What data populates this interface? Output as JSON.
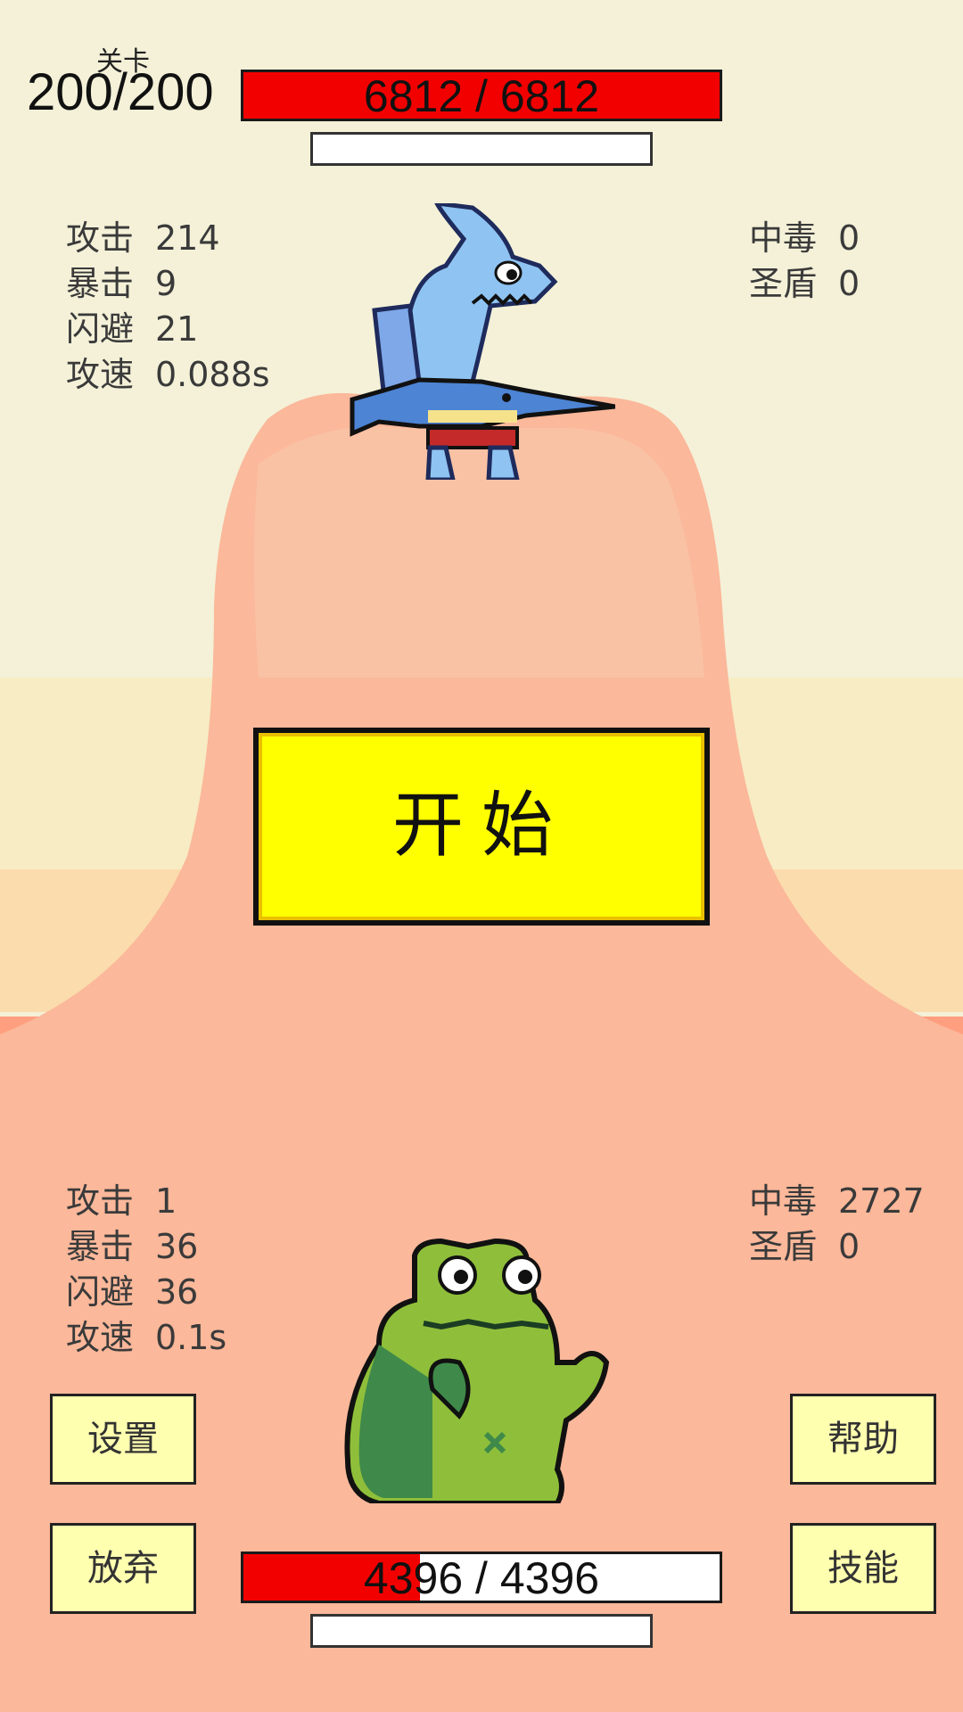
{
  "level": {
    "label": "关卡",
    "value": "200/200"
  },
  "enemy": {
    "name": "shark",
    "hp": {
      "text": "6812 / 6812",
      "fraction": 1.0
    },
    "shield_bar": {
      "fraction": 0
    },
    "stats_left": [
      {
        "label": "攻击",
        "value": "214"
      },
      {
        "label": "暴击",
        "value": "9"
      },
      {
        "label": "闪避",
        "value": "21"
      },
      {
        "label": "攻速",
        "value": "0.088s"
      }
    ],
    "stats_right": [
      {
        "label": "中毒",
        "value": "0"
      },
      {
        "label": "圣盾",
        "value": "0"
      }
    ]
  },
  "player": {
    "name": "frog",
    "hp": {
      "text": "4396 / 4396",
      "fraction": 0.37
    },
    "shield_bar": {
      "fraction": 0
    },
    "stats_left": [
      {
        "label": "攻击",
        "value": "1"
      },
      {
        "label": "暴击",
        "value": "36"
      },
      {
        "label": "闪避",
        "value": "36"
      },
      {
        "label": "攻速",
        "value": "0.1s"
      }
    ],
    "stats_right": [
      {
        "label": "中毒",
        "value": "2727"
      },
      {
        "label": "圣盾",
        "value": "0"
      }
    ]
  },
  "start_button": "开始",
  "buttons": {
    "settings": "设置",
    "give_up": "放弃",
    "help": "帮助",
    "skills": "技能"
  },
  "colors": {
    "sky_top": "#f3f0d6",
    "sky_mid": "#f6ebc2",
    "ground": "#ff9a7c",
    "hp_fill": "#f20000",
    "start_bg": "#ffff00",
    "button_bg": "#ffffb0"
  }
}
